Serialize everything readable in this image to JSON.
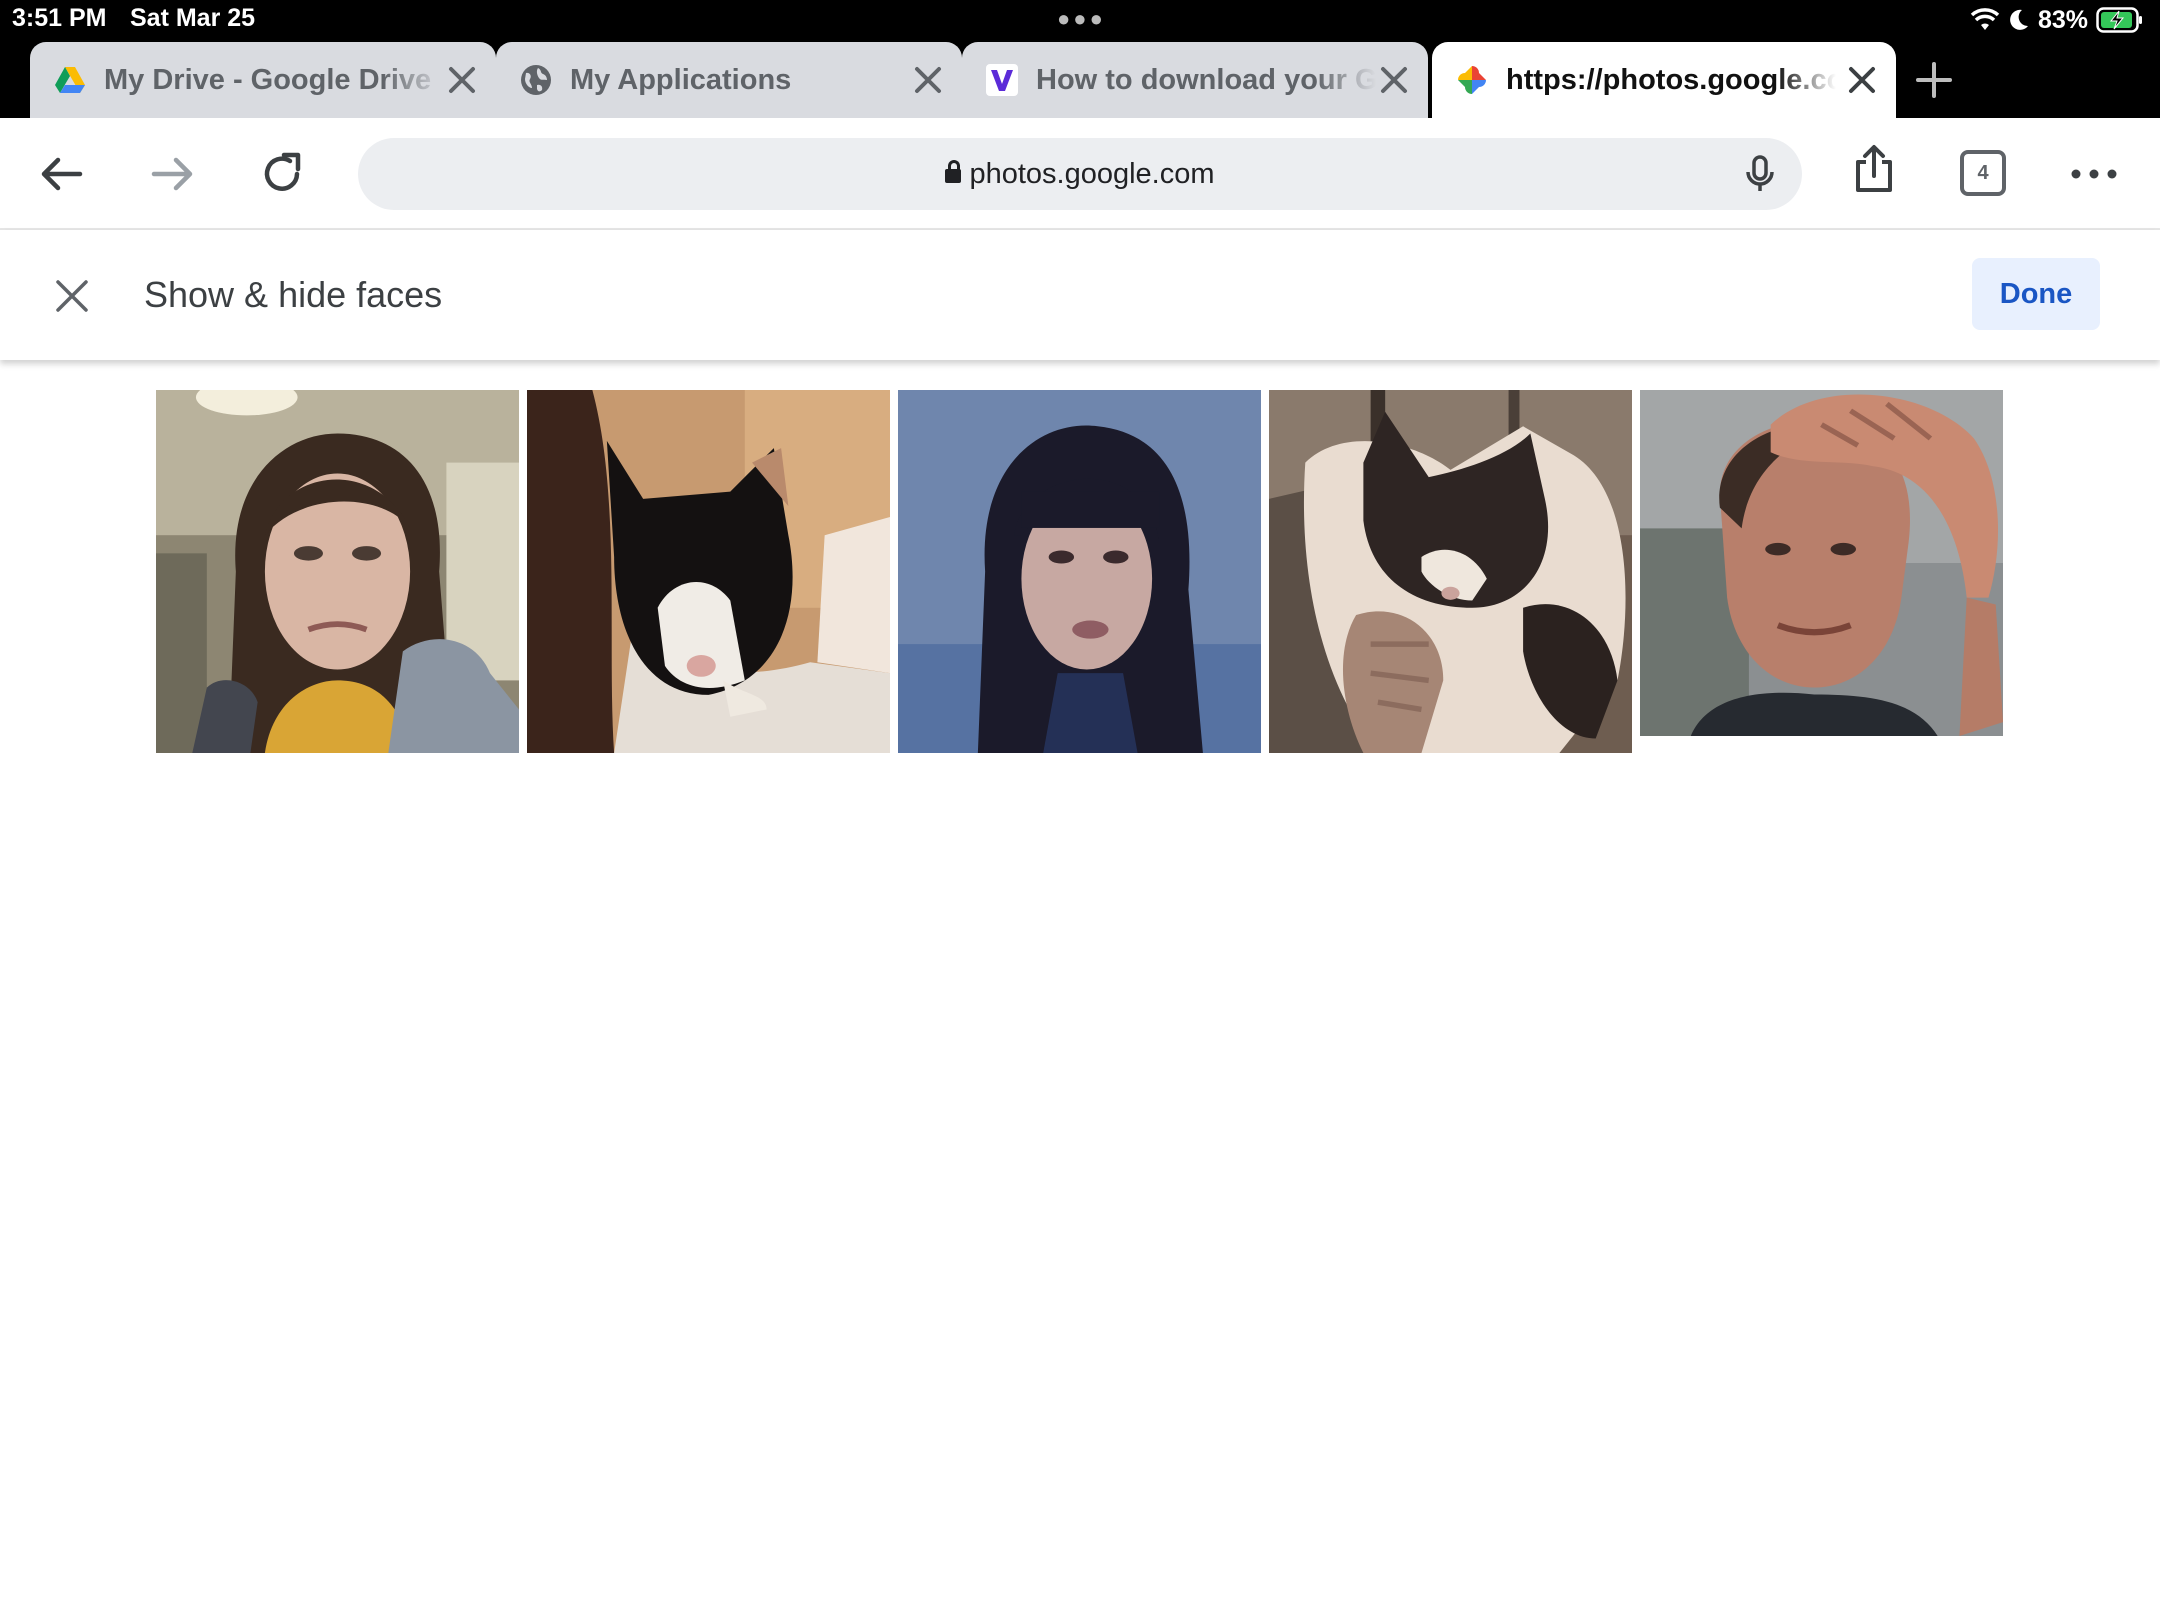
{
  "status_bar": {
    "time": "3:51 PM",
    "date": "Sat Mar 25",
    "battery": "83%",
    "icons": [
      "wifi-icon",
      "moon-icon",
      "battery-charging-icon"
    ]
  },
  "tabs": [
    {
      "title": "My Drive - Google Drive",
      "icon": "google-drive-icon",
      "active": false
    },
    {
      "title": "My Applications",
      "icon": "globe-icon",
      "active": false
    },
    {
      "title": "How to download your G",
      "icon": "v-logo-icon",
      "active": false
    },
    {
      "title": "https://photos.google.com",
      "icon": "google-photos-icon",
      "active": true
    }
  ],
  "toolbar": {
    "url": "photos.google.com",
    "tab_count": "4"
  },
  "faces_panel": {
    "title": "Show & hide faces",
    "done_label": "Done"
  },
  "faces": [
    {
      "name": "face-woman-brown-hair"
    },
    {
      "name": "face-black-white-cat"
    },
    {
      "name": "face-woman-dark-hair"
    },
    {
      "name": "face-ragdoll-cat"
    },
    {
      "name": "face-man-hand-on-head"
    }
  ],
  "colors": {
    "accent": "#1a56c4",
    "done_bg": "#e8f0fe"
  }
}
